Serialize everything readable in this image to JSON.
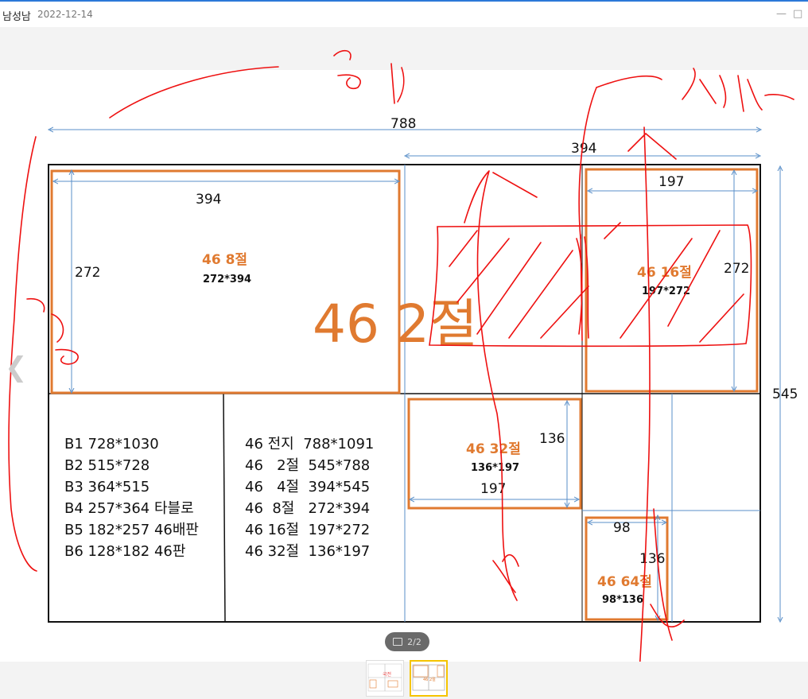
{
  "header": {
    "author": "남성남",
    "date": "2022-12-14",
    "minimize_symbol": "—",
    "maximize_symbol": "□"
  },
  "pager": {
    "page_indicator": "2/2"
  },
  "thumbnails": {
    "first_label": "국전",
    "second_label": "46 2절"
  },
  "colors": {
    "orange": "#e07a30",
    "dimension_blue": "#5a8fc8",
    "ink_red": "#e11",
    "accent_blue": "#2b78d8",
    "thumb_selected": "#f5c400"
  },
  "sheet": {
    "title": "46 2절",
    "overall_width": "788",
    "half_width": "394",
    "overall_height": "545",
    "cell_8": {
      "name": "46 8절",
      "size": "272*394",
      "width": "394",
      "height": "272"
    },
    "cell_16": {
      "name": "46 16절",
      "size": "197*272",
      "width": "197",
      "height": "272"
    },
    "cell_32": {
      "name": "46 32절",
      "size": "136*197",
      "width": "197",
      "height": "136"
    },
    "cell_64": {
      "name": "46 64절",
      "size": "98*136",
      "width": "98",
      "height": "136"
    },
    "b_list": [
      "B1 728*1030",
      "B2 515*728",
      "B3 364*515",
      "B4 257*364 타블로",
      "B5 182*257 46배판",
      "B6 128*182 46판"
    ],
    "s46_list": [
      "46 전지  788*1091",
      "46   2절  545*788",
      "46   4절  394*545",
      "46  8절   272*394",
      "46 16절  197*272",
      "46 32절  136*197"
    ]
  },
  "annotations": {
    "width_word": "8|",
    "height_word": "세로",
    "side_word": "ㄱ"
  }
}
